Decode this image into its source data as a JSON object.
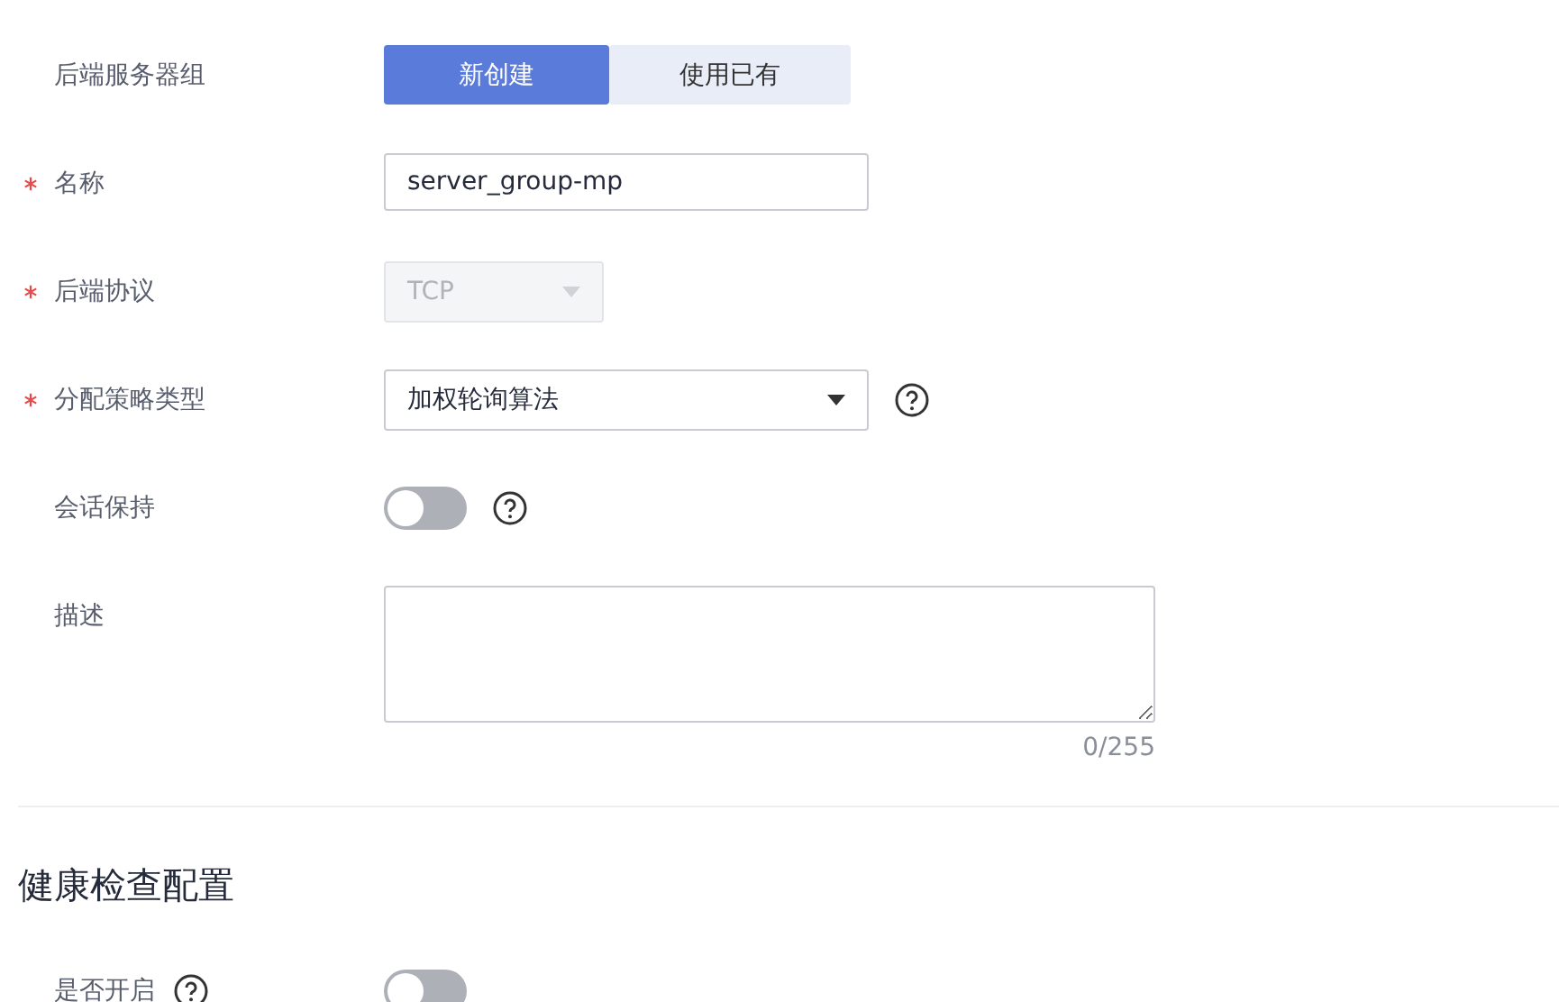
{
  "fields": [
    {
      "kind": "segmented",
      "label": "后端服务器组",
      "required": false,
      "options": [
        {
          "label": "新创建",
          "selected": true
        },
        {
          "label": "使用已有",
          "selected": false
        }
      ]
    },
    {
      "kind": "input",
      "label": "名称",
      "required": true,
      "value": "server_group-mp"
    },
    {
      "kind": "select",
      "label": "后端协议",
      "required": true,
      "value": "TCP",
      "disabled": true
    },
    {
      "kind": "select",
      "label": "分配策略类型",
      "required": true,
      "value": "加权轮询算法",
      "disabled": false,
      "help_icon": true
    },
    {
      "kind": "switch",
      "label": "会话保持",
      "required": false,
      "on": false,
      "help_icon": true
    },
    {
      "kind": "textarea",
      "label": "描述",
      "required": false,
      "counter": "0/255"
    }
  ],
  "health_check": {
    "title": "健康检查配置",
    "fields": [
      {
        "kind": "switch",
        "label": "是否开启",
        "required": false,
        "on": false,
        "label_help_icon": true
      }
    ]
  }
}
